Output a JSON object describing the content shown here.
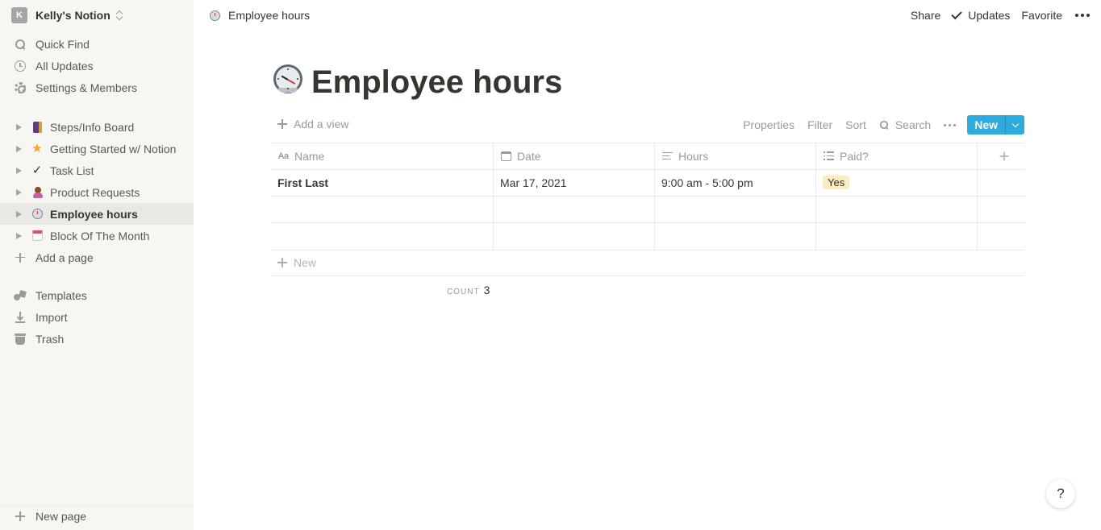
{
  "workspace": {
    "initial": "K",
    "name": "Kelly's Notion"
  },
  "sidebar": {
    "top_items": [
      {
        "label": "Quick Find",
        "icon": "search-icon"
      },
      {
        "label": "All Updates",
        "icon": "clock-icon"
      },
      {
        "label": "Settings & Members",
        "icon": "gear-icon"
      }
    ],
    "pages": [
      {
        "label": "Steps/Info Board",
        "icon": "board-icon"
      },
      {
        "label": "Getting Started w/ Notion",
        "icon": "star-icon"
      },
      {
        "label": "Task List",
        "icon": "checkmark-icon"
      },
      {
        "label": "Product Requests",
        "icon": "person-icon"
      },
      {
        "label": "Employee hours",
        "icon": "clock-icon",
        "active": true
      },
      {
        "label": "Block Of The Month",
        "icon": "calendar-icon"
      }
    ],
    "add_page": "Add a page",
    "bottom_items": [
      {
        "label": "Templates",
        "icon": "templates-icon"
      },
      {
        "label": "Import",
        "icon": "import-icon"
      },
      {
        "label": "Trash",
        "icon": "trash-icon"
      }
    ],
    "new_page": "New page"
  },
  "topbar": {
    "breadcrumb": "Employee hours",
    "share": "Share",
    "updates": "Updates",
    "favorite": "Favorite"
  },
  "page": {
    "title": "Employee hours",
    "icon": "alarm-clock-icon"
  },
  "viewbar": {
    "add_view": "Add a view",
    "properties": "Properties",
    "filter": "Filter",
    "sort": "Sort",
    "search": "Search",
    "new": "New"
  },
  "table": {
    "columns": [
      {
        "label": "Name",
        "icon": "text-type-icon"
      },
      {
        "label": "Date",
        "icon": "calendar-icon"
      },
      {
        "label": "Hours",
        "icon": "text-lines-icon"
      },
      {
        "label": "Paid?",
        "icon": "list-icon"
      }
    ],
    "rows": [
      {
        "name": "First Last",
        "date": "Mar 17, 2021",
        "hours": "9:00 am - 5:00 pm",
        "paid": "Yes"
      },
      {
        "name": "",
        "date": "",
        "hours": "",
        "paid": ""
      },
      {
        "name": "",
        "date": "",
        "hours": "",
        "paid": ""
      }
    ],
    "new_row": "New",
    "count_label": "COUNT",
    "count_value": "3"
  },
  "colors": {
    "accent": "#2eaadc",
    "sidebar_bg": "#f7f6f3",
    "tag_yes_bg": "#fbecc4"
  },
  "help": "?"
}
